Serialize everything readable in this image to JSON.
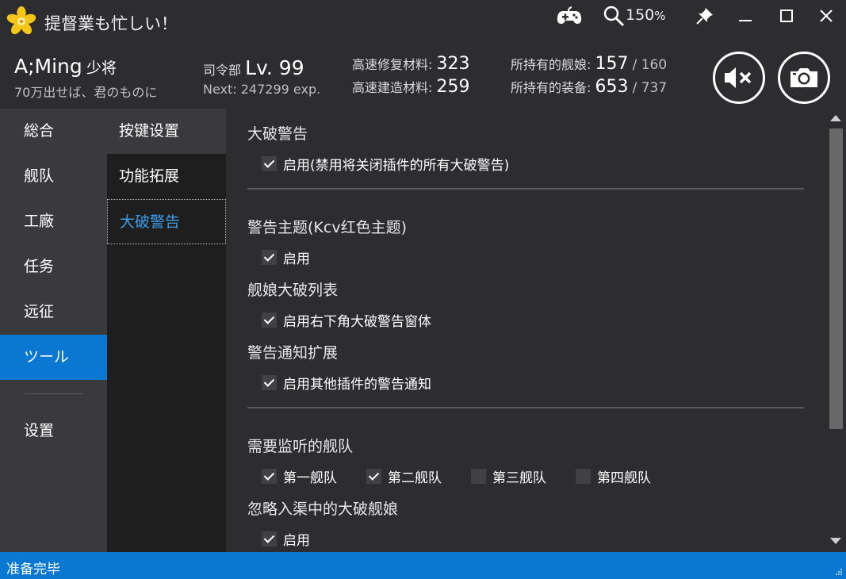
{
  "window": {
    "title": "提督業も忙しい！",
    "zoom_value": "150",
    "zoom_unit": "%",
    "accent_color": "#0a78d2"
  },
  "admiral": {
    "name": "A;Ming",
    "rank": "少将",
    "comment": "70万出せば、君のものに",
    "hq_label": "司令部",
    "level": "Lv. 99",
    "next_label": "Next: 247299 exp."
  },
  "resources": {
    "repair_label": "高速修复材料:",
    "repair_value": "323",
    "build_label": "高速建造材料:",
    "build_value": "259",
    "ships_label": "所持有的舰娘:",
    "ships_value": "157",
    "ships_max": "/ 160",
    "equip_label": "所持有的装备:",
    "equip_value": "653",
    "equip_max": "/ 737"
  },
  "icons": {
    "app": "sakura-flower-icon",
    "controller": "gamepad-icon",
    "zoom": "magnifier-icon",
    "pin": "pin-icon",
    "minimize": "minimize-icon",
    "maximize": "maximize-icon",
    "close": "close-icon",
    "mute": "speaker-muted-icon",
    "screenshot": "camera-icon"
  },
  "nav": {
    "items": [
      {
        "label": "総合"
      },
      {
        "label": "舰队"
      },
      {
        "label": "工廠"
      },
      {
        "label": "任务"
      },
      {
        "label": "远征"
      },
      {
        "label": "ツール"
      },
      {
        "label": "设置"
      }
    ]
  },
  "subnav": {
    "items": [
      {
        "label": "按键设置"
      },
      {
        "label": "功能拓展"
      },
      {
        "label": "大破警告"
      }
    ]
  },
  "content": {
    "section1_title": "大破警告",
    "section1_cb": "启用(禁用将关闭插件的所有大破警告)",
    "section2_title": "警告主题(Kcv红色主题)",
    "section2_cb": "启用",
    "section3_title": "舰娘大破列表",
    "section3_cb": "启用右下角大破警告窗体",
    "section4_title": "警告通知扩展",
    "section4_cb": "启用其他插件的警告通知",
    "section5_title": "需要监听的舰队",
    "fleets": [
      {
        "label": "第一舰队",
        "checked": true
      },
      {
        "label": "第二舰队",
        "checked": true
      },
      {
        "label": "第三舰队",
        "checked": false
      },
      {
        "label": "第四舰队",
        "checked": false
      }
    ],
    "section6_title": "忽略入渠中的大破舰娘",
    "section6_cb": "启用"
  },
  "status": {
    "text": "准备完毕"
  }
}
